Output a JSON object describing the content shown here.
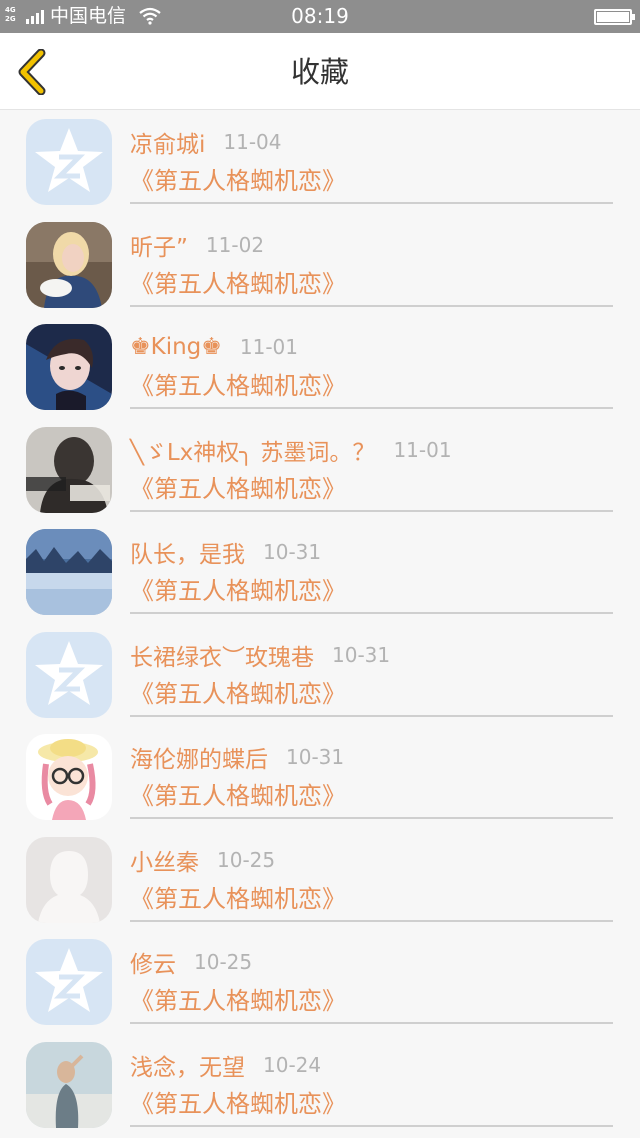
{
  "status_bar": {
    "network": [
      "4G",
      "2G"
    ],
    "carrier": "中国电信",
    "time": "08:19"
  },
  "header": {
    "title": "收藏",
    "back_icon": "chevron-left-icon",
    "accent_color": "#f2c200"
  },
  "colors": {
    "nickname": "#e8925a",
    "date": "#b3b3b3",
    "divider": "#cfcfcf"
  },
  "favorites": [
    {
      "nickname": "凉俞城i",
      "date": "11-04",
      "title": "《第五人格蜘机恋》",
      "avatar": "default-qq-icon"
    },
    {
      "nickname": "昕子”",
      "date": "11-02",
      "title": "《第五人格蜘机恋》",
      "avatar": "photo-blonde"
    },
    {
      "nickname": "♚King♚",
      "date": "11-01",
      "title": "《第五人格蜘机恋》",
      "avatar": "photo-anime-boy"
    },
    {
      "nickname": "╲ゞLx神权╮ 苏墨词。？",
      "date": "11-01",
      "title": "《第五人格蜘机恋》",
      "avatar": "photo-dark"
    },
    {
      "nickname": "队长，是我",
      "date": "10-31",
      "title": "《第五人格蜘机恋》",
      "avatar": "photo-snow"
    },
    {
      "nickname": "长裙绿衣︶玫瑰巷",
      "date": "10-31",
      "title": "《第五人格蜘机恋》",
      "avatar": "default-qq-icon"
    },
    {
      "nickname": "海伦娜的蝶后",
      "date": "10-31",
      "title": "《第五人格蜘机恋》",
      "avatar": "photo-cartoon-girl"
    },
    {
      "nickname": "小丝秦",
      "date": "10-25",
      "title": "《第五人格蜘机恋》",
      "avatar": "silhouette-icon"
    },
    {
      "nickname": "修云",
      "date": "10-25",
      "title": "《第五人格蜘机恋》",
      "avatar": "default-qq-icon"
    },
    {
      "nickname": "浅念，无望",
      "date": "10-24",
      "title": "《第五人格蜘机恋》",
      "avatar": "photo-beach"
    }
  ]
}
